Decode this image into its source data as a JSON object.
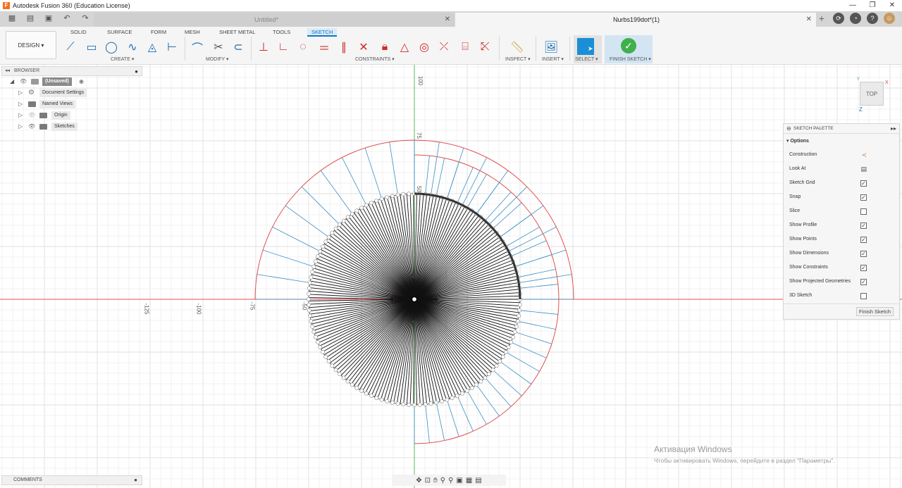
{
  "window": {
    "title": "Autodesk Fusion 360 (Education License)",
    "app_icon": "fusion-logo-icon",
    "controls": [
      "minimize-icon",
      "restore-icon",
      "close-icon"
    ],
    "control_glyphs": [
      "—",
      "❐",
      "✕"
    ]
  },
  "tabs": [
    {
      "label": "Untitled*",
      "active": false
    },
    {
      "label": "Nurbs199dot*(1)",
      "active": true
    }
  ],
  "workspace": {
    "label": "DESIGN"
  },
  "workspace_tabs": [
    {
      "label": "SOLID"
    },
    {
      "label": "SURFACE"
    },
    {
      "label": "FORM"
    },
    {
      "label": "MESH"
    },
    {
      "label": "SHEET METAL"
    },
    {
      "label": "TOOLS"
    },
    {
      "label": "SKETCH",
      "active": true
    }
  ],
  "toolbar": {
    "create_label": "CREATE",
    "modify_label": "MODIFY",
    "constraints_label": "CONSTRAINTS",
    "inspect_label": "INSPECT",
    "insert_label": "INSERT",
    "select_label": "SELECT",
    "finish_label": "FINISH SKETCH"
  },
  "browser": {
    "title": "BROWSER",
    "root": "(Unsaved)",
    "items": [
      {
        "label": "Document Settings"
      },
      {
        "label": "Named Views"
      },
      {
        "label": "Origin"
      },
      {
        "label": "Sketches"
      }
    ]
  },
  "palette": {
    "title": "SKETCH PALETTE",
    "section": "Options",
    "options": [
      {
        "label": "Construction",
        "type": "icon",
        "icon": "construction-icon"
      },
      {
        "label": "Look At",
        "type": "icon",
        "icon": "look-at-icon"
      },
      {
        "label": "Sketch Grid",
        "type": "check",
        "checked": true
      },
      {
        "label": "Snap",
        "type": "check",
        "checked": true
      },
      {
        "label": "Slice",
        "type": "check",
        "checked": false
      },
      {
        "label": "Show Profile",
        "type": "check",
        "checked": true
      },
      {
        "label": "Show Points",
        "type": "check",
        "checked": true
      },
      {
        "label": "Show Dimensions",
        "type": "check",
        "checked": true
      },
      {
        "label": "Show Constraints",
        "type": "check",
        "checked": true
      },
      {
        "label": "Show Projected Geometries",
        "type": "check",
        "checked": true
      },
      {
        "label": "3D Sketch",
        "type": "check",
        "checked": false
      }
    ],
    "finish_button": "Finish Sketch"
  },
  "comments": {
    "title": "COMMENTS"
  },
  "viewcube": {
    "label": "TOP",
    "axis_x": "X",
    "axis_y": "Y",
    "axis_z": "Z"
  },
  "rulers": {
    "vertical": [
      "100",
      "75",
      "50"
    ],
    "horizontal": [
      "-125",
      "-100",
      "-75",
      "-50"
    ]
  },
  "activation": {
    "title": "Активация Windows",
    "subtitle": "Чтобы активировать Windows, перейдите в раздел \"Параметры\"."
  },
  "colors": {
    "accent": "#0b79c7",
    "axis_red": "#e05050",
    "axis_green": "#5cb85c",
    "sketch_blue": "#3a8fc4"
  }
}
